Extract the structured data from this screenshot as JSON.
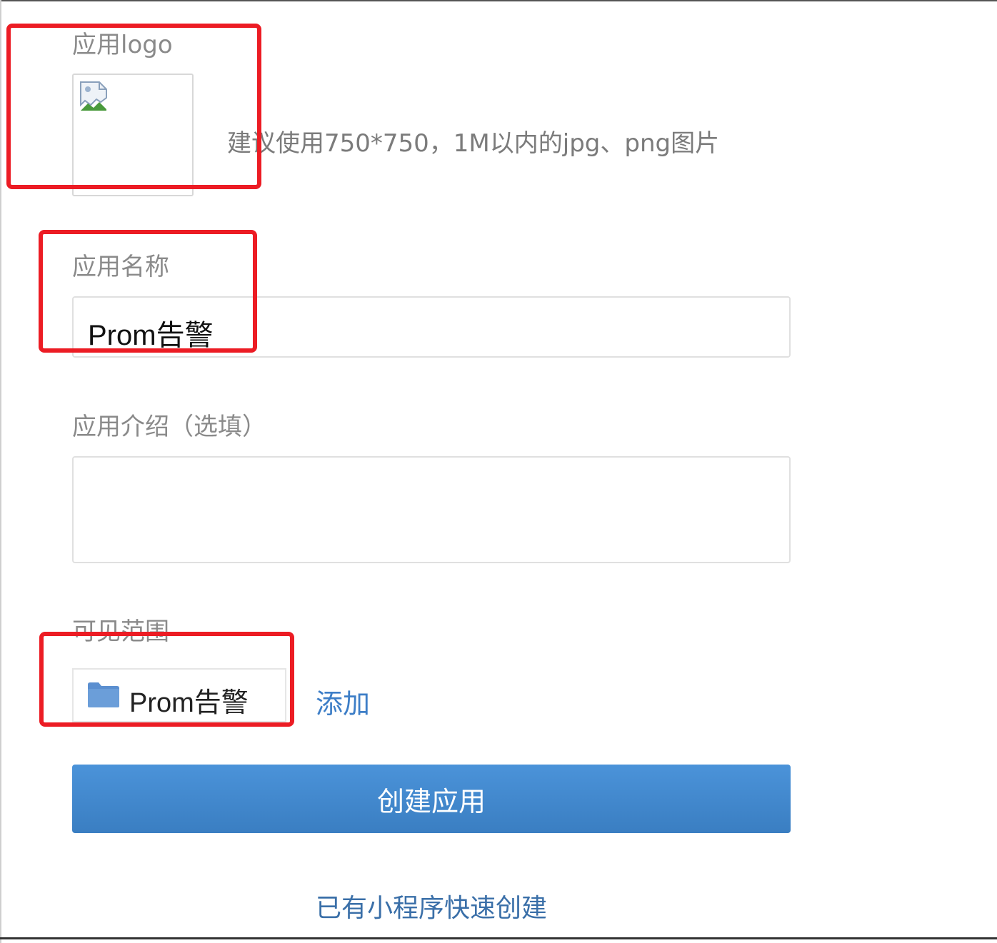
{
  "form": {
    "logo": {
      "label": "应用logo",
      "hint": "建议使用750*750，1M以内的jpg、png图片",
      "icon": "broken-image-icon"
    },
    "name": {
      "label": "应用名称",
      "value": "Prom告警"
    },
    "intro": {
      "label": "应用介绍（选填）",
      "value": ""
    },
    "visibility": {
      "label": "可见范围",
      "selected_item": "Prom告警",
      "icon": "folder-icon",
      "add_label": "添加"
    },
    "submit_label": "创建应用",
    "quick_create_label": "已有小程序快速创建"
  },
  "colors": {
    "primary_button": "#3f87cf",
    "link": "#3d7ec7",
    "annotation_red": "#ec1c24",
    "folder": "#5b8fd0"
  }
}
